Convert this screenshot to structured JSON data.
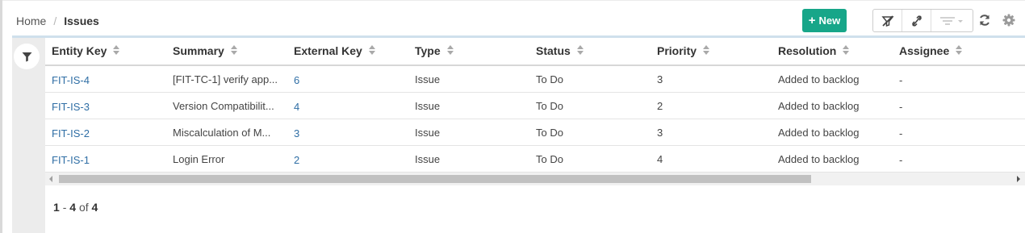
{
  "breadcrumb": {
    "home": "Home",
    "separator": "/",
    "current": "Issues"
  },
  "toolbar": {
    "new_label": "New",
    "new_color": "#17a689",
    "icons": [
      "filter-off-icon",
      "unlink-icon",
      "filter-dropdown-icon",
      "refresh-icon",
      "gear-icon"
    ]
  },
  "table": {
    "columns": [
      "Entity Key",
      "Summary",
      "External Key",
      "Type",
      "Status",
      "Priority",
      "Resolution",
      "Assignee"
    ],
    "rows": [
      {
        "key": "FIT-IS-4",
        "summary": "[FIT-TC-1] verify app...",
        "external": "6",
        "type": "Issue",
        "status": "To Do",
        "priority": "3",
        "resolution": "Added to backlog",
        "assignee": "-"
      },
      {
        "key": "FIT-IS-3",
        "summary": "Version Compatibilit...",
        "external": "4",
        "type": "Issue",
        "status": "To Do",
        "priority": "2",
        "resolution": "Added to backlog",
        "assignee": "-"
      },
      {
        "key": "FIT-IS-2",
        "summary": "Miscalculation of M...",
        "external": "3",
        "type": "Issue",
        "status": "To Do",
        "priority": "3",
        "resolution": "Added to backlog",
        "assignee": "-"
      },
      {
        "key": "FIT-IS-1",
        "summary": "Login Error",
        "external": "2",
        "type": "Issue",
        "status": "To Do",
        "priority": "4",
        "resolution": "Added to backlog",
        "assignee": "-"
      }
    ]
  },
  "pager": {
    "from": "1",
    "dash": "-",
    "to": "4",
    "of": "of",
    "total": "4"
  },
  "colors": {
    "link": "#2f6ea5",
    "accent": "#cfe0ec"
  }
}
